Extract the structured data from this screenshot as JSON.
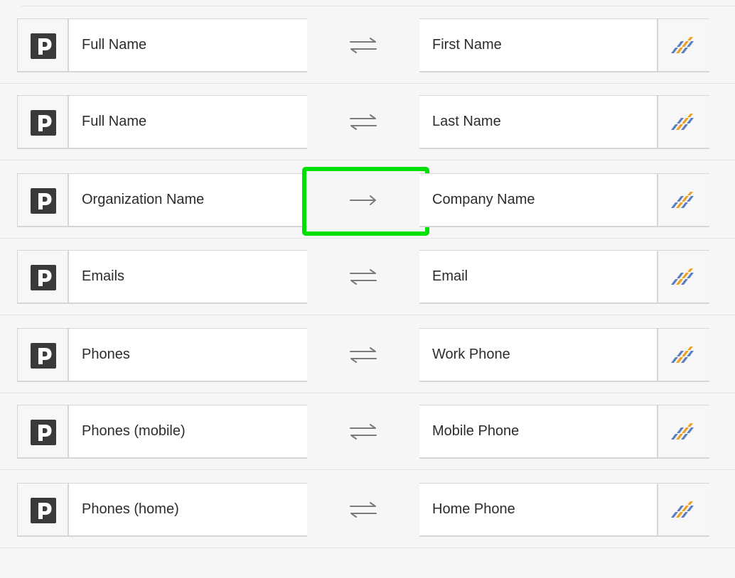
{
  "mappings": [
    {
      "source_field": "Full Name",
      "target_field": "First Name",
      "direction": "two-way",
      "direction_icon": "swap-arrows-icon",
      "highlighted": false
    },
    {
      "source_field": "Full Name",
      "target_field": "Last Name",
      "direction": "two-way",
      "direction_icon": "swap-arrows-icon",
      "highlighted": false
    },
    {
      "source_field": "Organization Name",
      "target_field": "Company Name",
      "direction": "one-way",
      "direction_icon": "arrow-right-icon",
      "highlighted": true
    },
    {
      "source_field": "Emails",
      "target_field": "Email",
      "direction": "two-way",
      "direction_icon": "swap-arrows-icon",
      "highlighted": false
    },
    {
      "source_field": "Phones",
      "target_field": "Work Phone",
      "direction": "two-way",
      "direction_icon": "swap-arrows-icon",
      "highlighted": false
    },
    {
      "source_field": "Phones (mobile)",
      "target_field": "Mobile Phone",
      "direction": "two-way",
      "direction_icon": "swap-arrows-icon",
      "highlighted": false
    },
    {
      "source_field": "Phones (home)",
      "target_field": "Home Phone",
      "direction": "two-way",
      "direction_icon": "swap-arrows-icon",
      "highlighted": false
    }
  ],
  "icons": {
    "source_app": "pipedrive-logo-icon",
    "target_app": "target-app-logo-icon"
  },
  "colors": {
    "highlight": "#00e000",
    "pipedrive_logo": "#3a3a3a",
    "target_logo_blue": "#5b7fc0",
    "target_logo_orange": "#f0a020"
  }
}
